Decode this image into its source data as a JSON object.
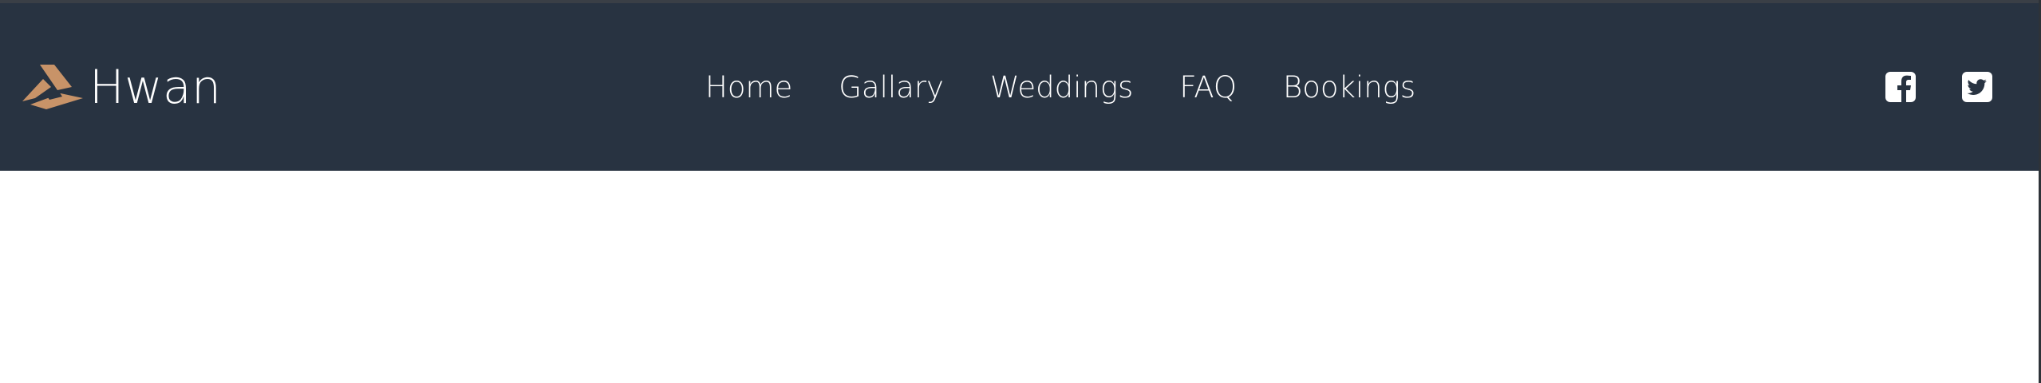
{
  "brand": {
    "name": "Hwan",
    "logo_icon": "mountain-logo-icon",
    "logo_color": "#c89368"
  },
  "nav": {
    "items": [
      {
        "label": "Home"
      },
      {
        "label": "Gallary"
      },
      {
        "label": "Weddings"
      },
      {
        "label": "FAQ"
      },
      {
        "label": "Bookings"
      }
    ]
  },
  "social": {
    "facebook_icon": "facebook-icon",
    "twitter_icon": "twitter-icon"
  },
  "colors": {
    "navbar_background": "#283341",
    "nav_text": "#ffffff",
    "page_background": "#ffffff"
  }
}
